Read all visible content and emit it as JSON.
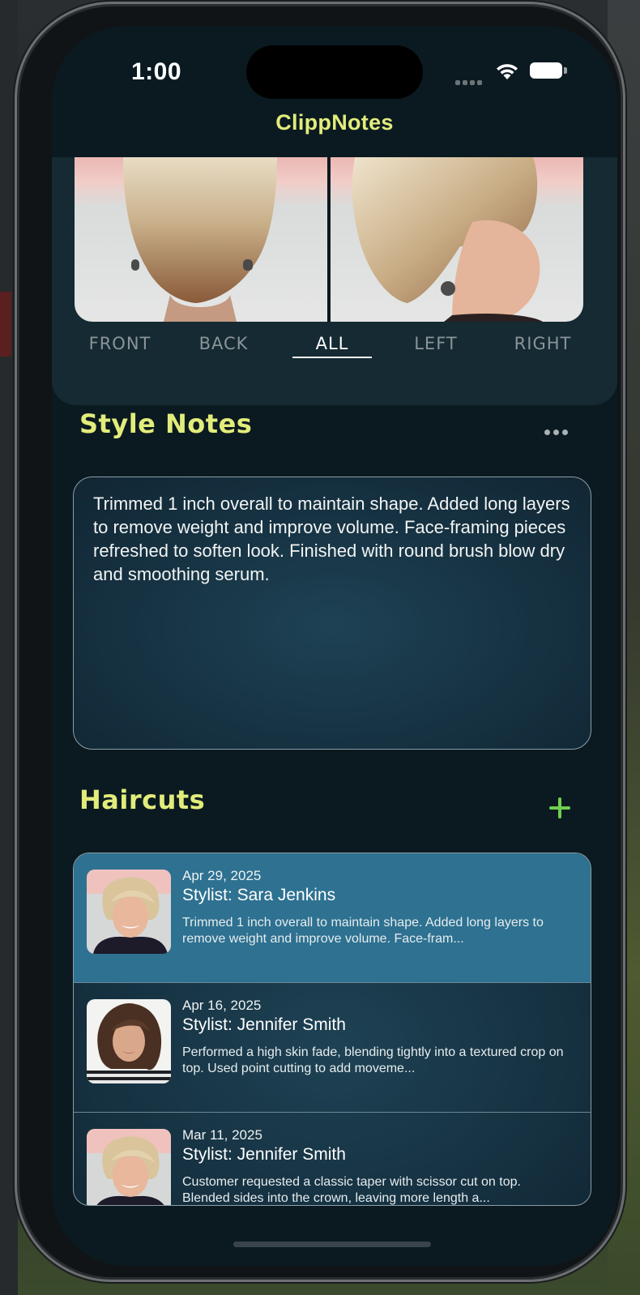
{
  "status_bar": {
    "time": "1:00"
  },
  "nav": {
    "title": "ClippNotes"
  },
  "photo_tabs": [
    "FRONT",
    "BACK",
    "ALL",
    "LEFT",
    "RIGHT"
  ],
  "photo_tabs_selected": "ALL",
  "style_notes": {
    "title": "Style Notes",
    "text": "Trimmed 1 inch overall to maintain shape. Added long layers to remove weight and improve volume. Face-framing pieces refreshed to soften look. Finished with round brush blow dry and smoothing serum."
  },
  "haircuts": {
    "title": "Haircuts",
    "items": [
      {
        "date": "Apr 29, 2025",
        "stylist": "Stylist: Sara Jenkins",
        "notes": "Trimmed 1 inch overall to maintain shape. Added long layers to remove weight and improve volume. Face-fram...",
        "selected": true
      },
      {
        "date": "Apr 16, 2025",
        "stylist": "Stylist: Jennifer Smith",
        "notes": "Performed a high skin fade, blending tightly into a textured crop on top. Used point cutting to add moveme...",
        "selected": false
      },
      {
        "date": "Mar 11, 2025",
        "stylist": "Stylist: Jennifer Smith",
        "notes": "Customer requested a classic taper with scissor cut on top. Blended sides into the crown, leaving more length a...",
        "selected": false
      }
    ]
  },
  "colors": {
    "accent_yellow": "#e2ec7a",
    "add_green": "#6fcf4e",
    "selected_row": "#2e7191",
    "background": "#0b1a21"
  },
  "icons": [
    "wifi-icon",
    "battery-icon",
    "signal-icon",
    "more-icon",
    "add-icon"
  ]
}
